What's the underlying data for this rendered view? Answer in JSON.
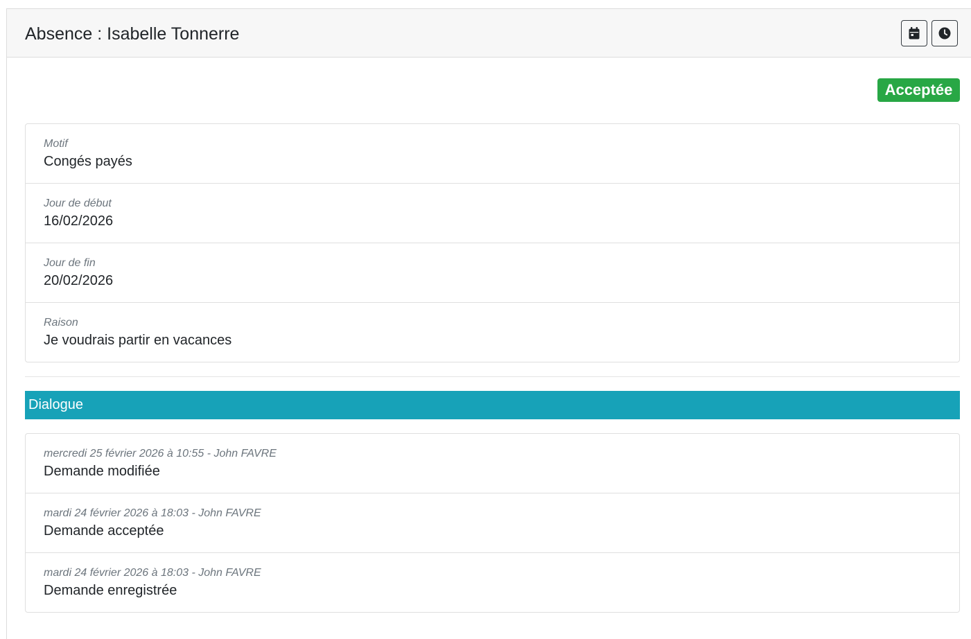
{
  "header": {
    "title": "Absence : Isabelle Tonnerre",
    "buttons": [
      {
        "name": "calendar-icon"
      },
      {
        "name": "clock-icon"
      }
    ]
  },
  "status": {
    "label": "Acceptée",
    "color": "#28a745"
  },
  "details": [
    {
      "label": "Motif",
      "value": "Congés payés"
    },
    {
      "label": "Jour de début",
      "value": "16/02/2026"
    },
    {
      "label": "Jour de fin",
      "value": "20/02/2026"
    },
    {
      "label": "Raison",
      "value": "Je voudrais partir en vacances"
    }
  ],
  "dialogue": {
    "title": "Dialogue",
    "color": "#17a2b8",
    "entries": [
      {
        "meta": "mercredi 25 février 2026 à 10:55 - John FAVRE",
        "text": "Demande modifiée"
      },
      {
        "meta": "mardi 24 février 2026 à 18:03 - John FAVRE",
        "text": "Demande acceptée"
      },
      {
        "meta": "mardi 24 février 2026 à 18:03 - John FAVRE",
        "text": "Demande enregistrée"
      }
    ]
  }
}
